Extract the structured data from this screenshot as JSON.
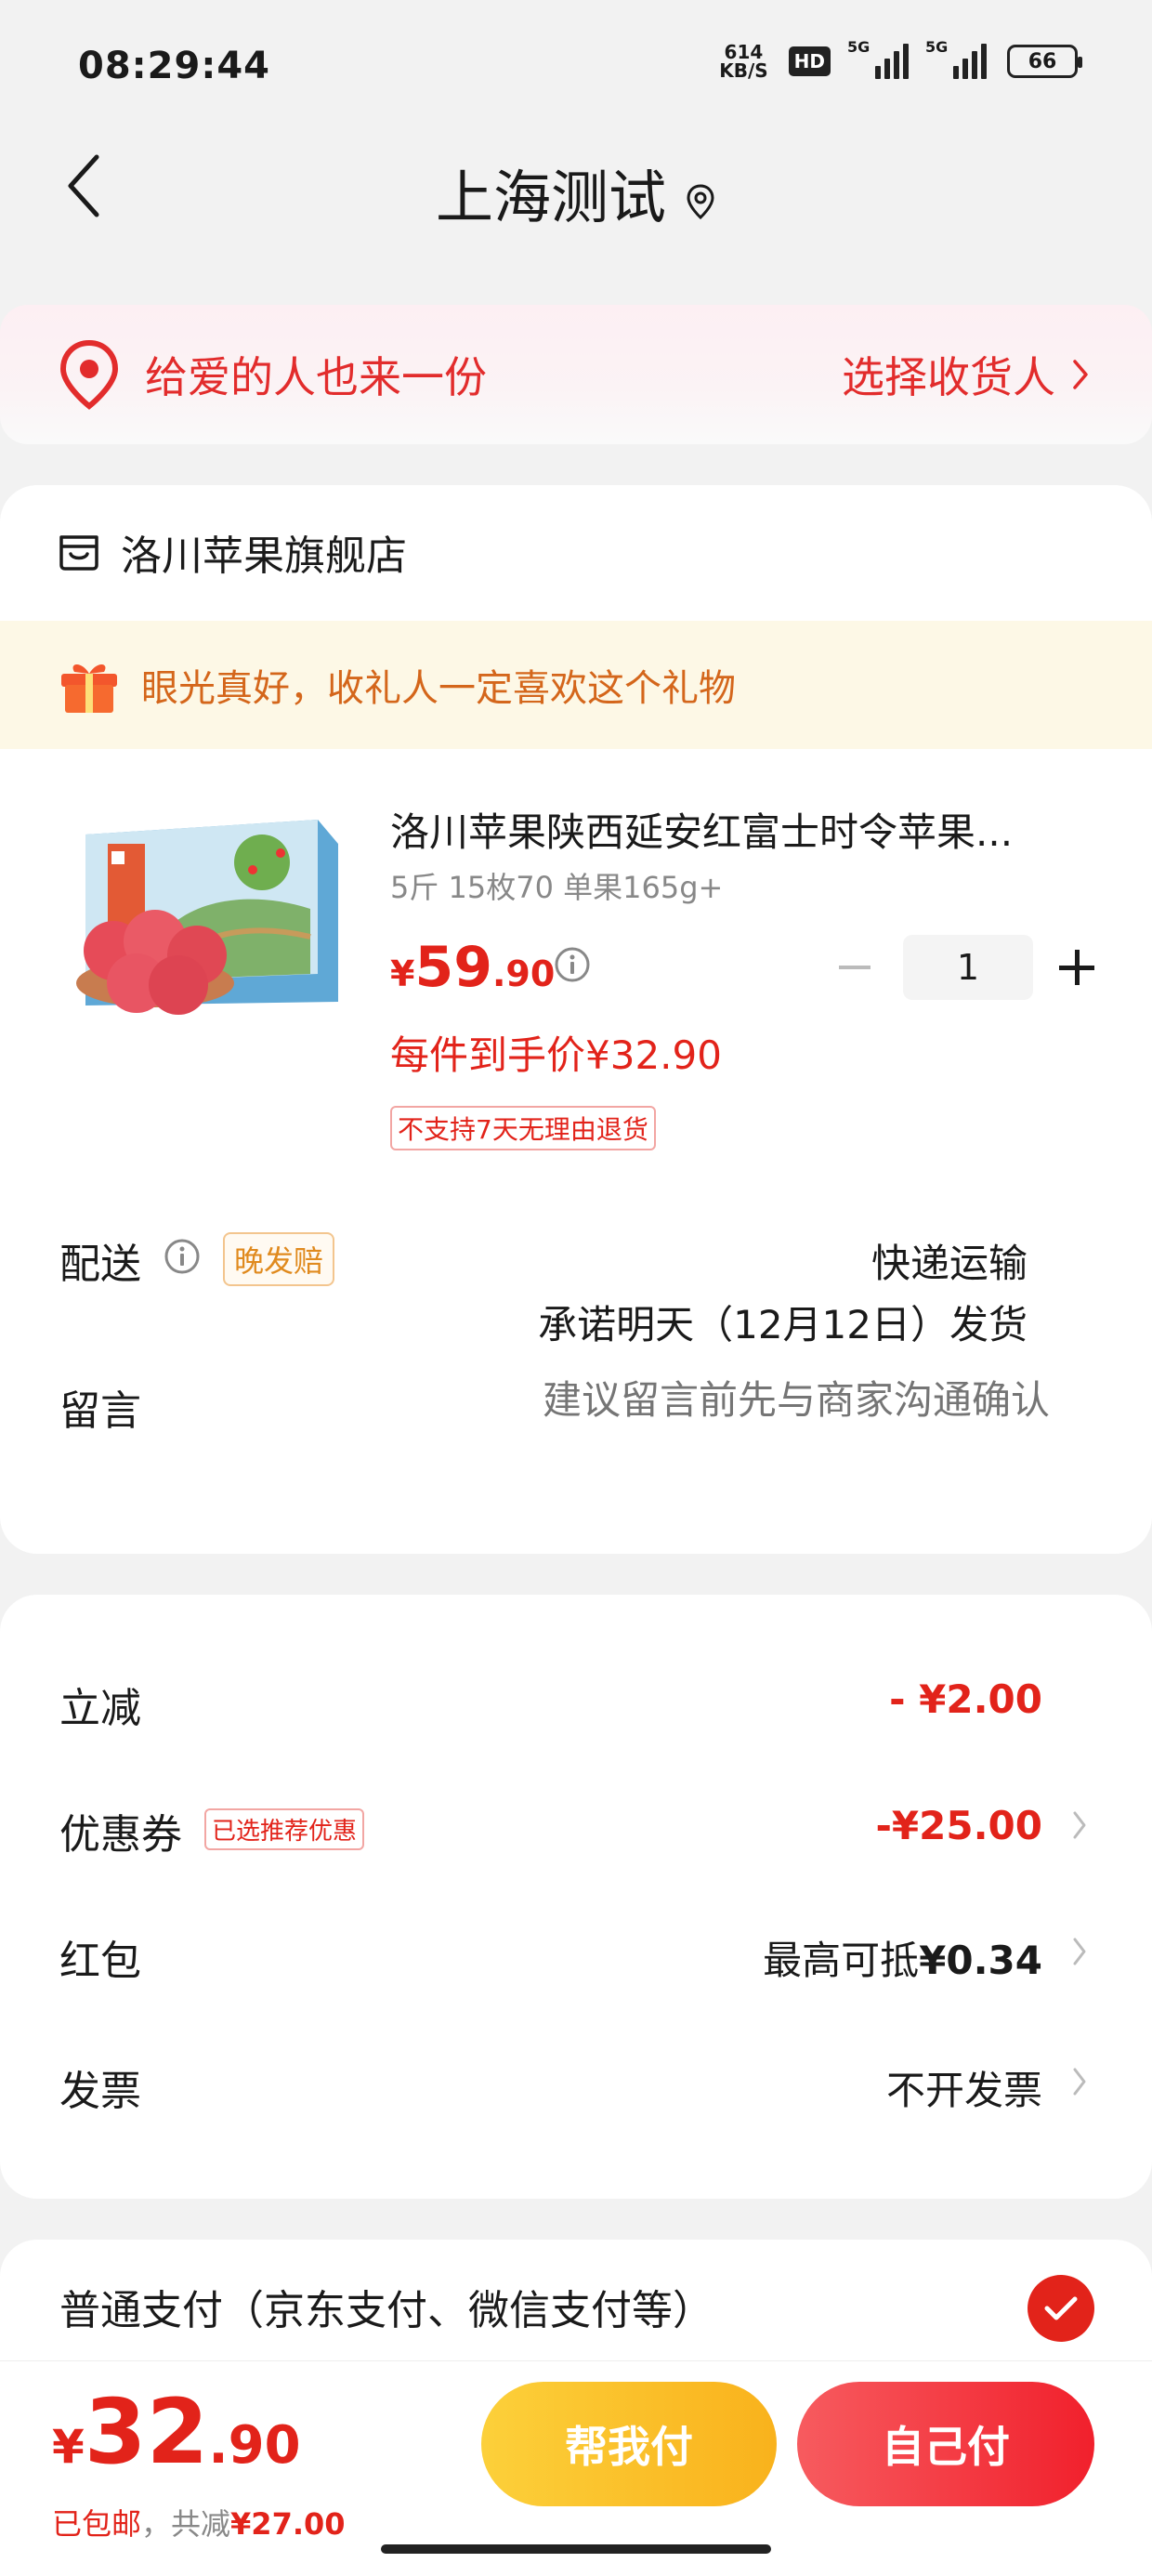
{
  "status_bar": {
    "time": "08:29:44",
    "net_speed_value": "614",
    "net_speed_unit": "KB/S",
    "hd_label": "HD",
    "signal1_tag": "5G",
    "signal2_tag": "5G",
    "battery": "66"
  },
  "nav": {
    "title": "上海测试"
  },
  "gift_bar": {
    "text": "给爱的人也来一份",
    "link": "选择收货人"
  },
  "store": {
    "name": "洛川苹果旗舰店"
  },
  "promo": {
    "text": "眼光真好，收礼人一定喜欢这个礼物"
  },
  "product": {
    "title": "洛川苹果陕西延安红富士时令苹果...",
    "spec": "5斤 15枚70 单果165g+",
    "price_symbol": "¥",
    "price_int": "59",
    "price_dec": ".90",
    "unit_price": "每件到手价¥32.90",
    "no_return": "不支持7天无理由退货",
    "quantity": "1"
  },
  "delivery": {
    "label": "配送",
    "late_badge": "晚发赔",
    "method": "快递运输",
    "promise": "承诺明天（12月12日）发货"
  },
  "remark": {
    "label": "留言",
    "placeholder": "建议留言前先与商家沟通确认"
  },
  "discounts": {
    "instant_label": "立减",
    "instant_value": "- ¥2.00",
    "coupon_label": "优惠券",
    "coupon_tag": "已选推荐优惠",
    "coupon_value": "-¥25.00",
    "redpacket_label": "红包",
    "redpacket_prefix": "最高可抵",
    "redpacket_value": "¥0.34",
    "invoice_label": "发票",
    "invoice_value": "不开发票"
  },
  "payment": {
    "label": "普通支付（京东支付、微信支付等）"
  },
  "bottom": {
    "yen": "¥",
    "total_int": "32",
    "total_dec": ".90",
    "free_shipping": "已包邮",
    "saved_prefix": "，共减",
    "saved_value": "¥27.00",
    "help_pay": "帮我付",
    "self_pay": "自己付"
  },
  "colors": {
    "accent_red": "#e2231a",
    "promo_orange": "#d4661b",
    "help_button": "#f9b21c",
    "self_button": "#f1202c"
  }
}
